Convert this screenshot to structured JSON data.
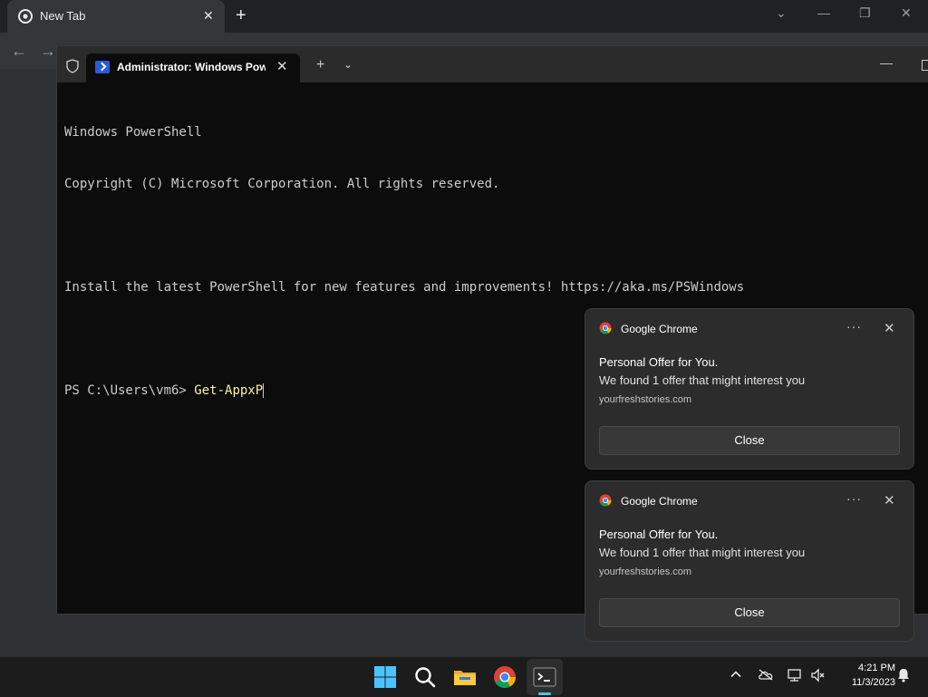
{
  "chrome": {
    "tab_title": "New Tab",
    "tab_close": "✕",
    "new_tab": "+",
    "controls": [
      "⌄",
      "—",
      "❐",
      "✕"
    ],
    "nav": [
      "←",
      "→"
    ]
  },
  "terminal": {
    "tab_title": "Administrator: Windows PowerShell",
    "tab_close": "✕",
    "add": "+",
    "dropdown": "⌄",
    "minimize": "—",
    "lines": [
      "Windows PowerShell",
      "Copyright (C) Microsoft Corporation. All rights reserved.",
      "",
      "Install the latest PowerShell for new features and improvements! https://aka.ms/PSWindows",
      ""
    ],
    "prompt": "PS C:\\Users\\vm6> ",
    "command": "Get-AppxP"
  },
  "notifications": [
    {
      "app": "Google Chrome",
      "more": "···",
      "close_x": "✕",
      "title": "Personal Offer for You.",
      "body": "We found 1 offer that might interest you",
      "source": "yourfreshstories.com",
      "button": "Close"
    },
    {
      "app": "Google Chrome",
      "more": "···",
      "close_x": "✕",
      "title": "Personal Offer for You.",
      "body": "We found 1 offer that might interest you",
      "source": "yourfreshstories.com",
      "button": "Close"
    }
  ],
  "taskbar": {
    "apps": [
      "windows-start-icon",
      "search-icon",
      "file-explorer-icon",
      "chrome-icon",
      "terminal-icon"
    ],
    "tray": [
      "chevron-up-icon",
      "onedrive-icon",
      "network-icon",
      "volume-muted-icon",
      "notification-icon"
    ],
    "time": "4:21 PM",
    "date": "11/3/2023"
  },
  "colors": {
    "terminal_bg": "#0c0c0c",
    "command_yellow": "#f9f1a5",
    "accent": "#4cc2ff"
  }
}
